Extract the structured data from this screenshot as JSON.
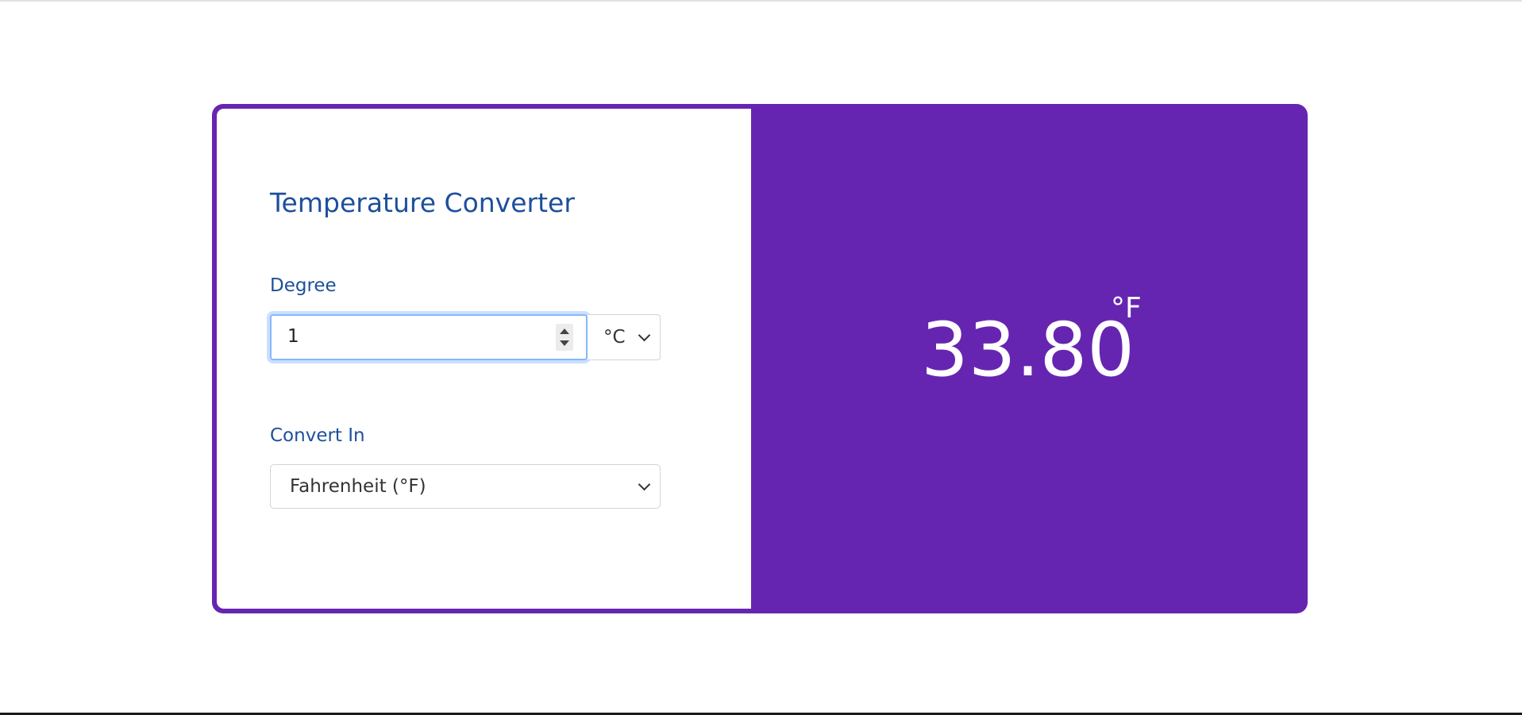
{
  "app": {
    "title": "Temperature Converter"
  },
  "degree": {
    "label": "Degree",
    "value": "1",
    "unit_selected": "°C"
  },
  "convert": {
    "label": "Convert In",
    "selected": "Fahrenheit (°F)"
  },
  "result": {
    "value": "33.80",
    "unit": "°F"
  },
  "colors": {
    "accent": "#6625b1",
    "heading": "#1d4f9c",
    "focus_ring": "#86b7fe"
  },
  "icons": {
    "spinner": "number-spinner-icon",
    "dropdown": "chevron-down-icon"
  }
}
